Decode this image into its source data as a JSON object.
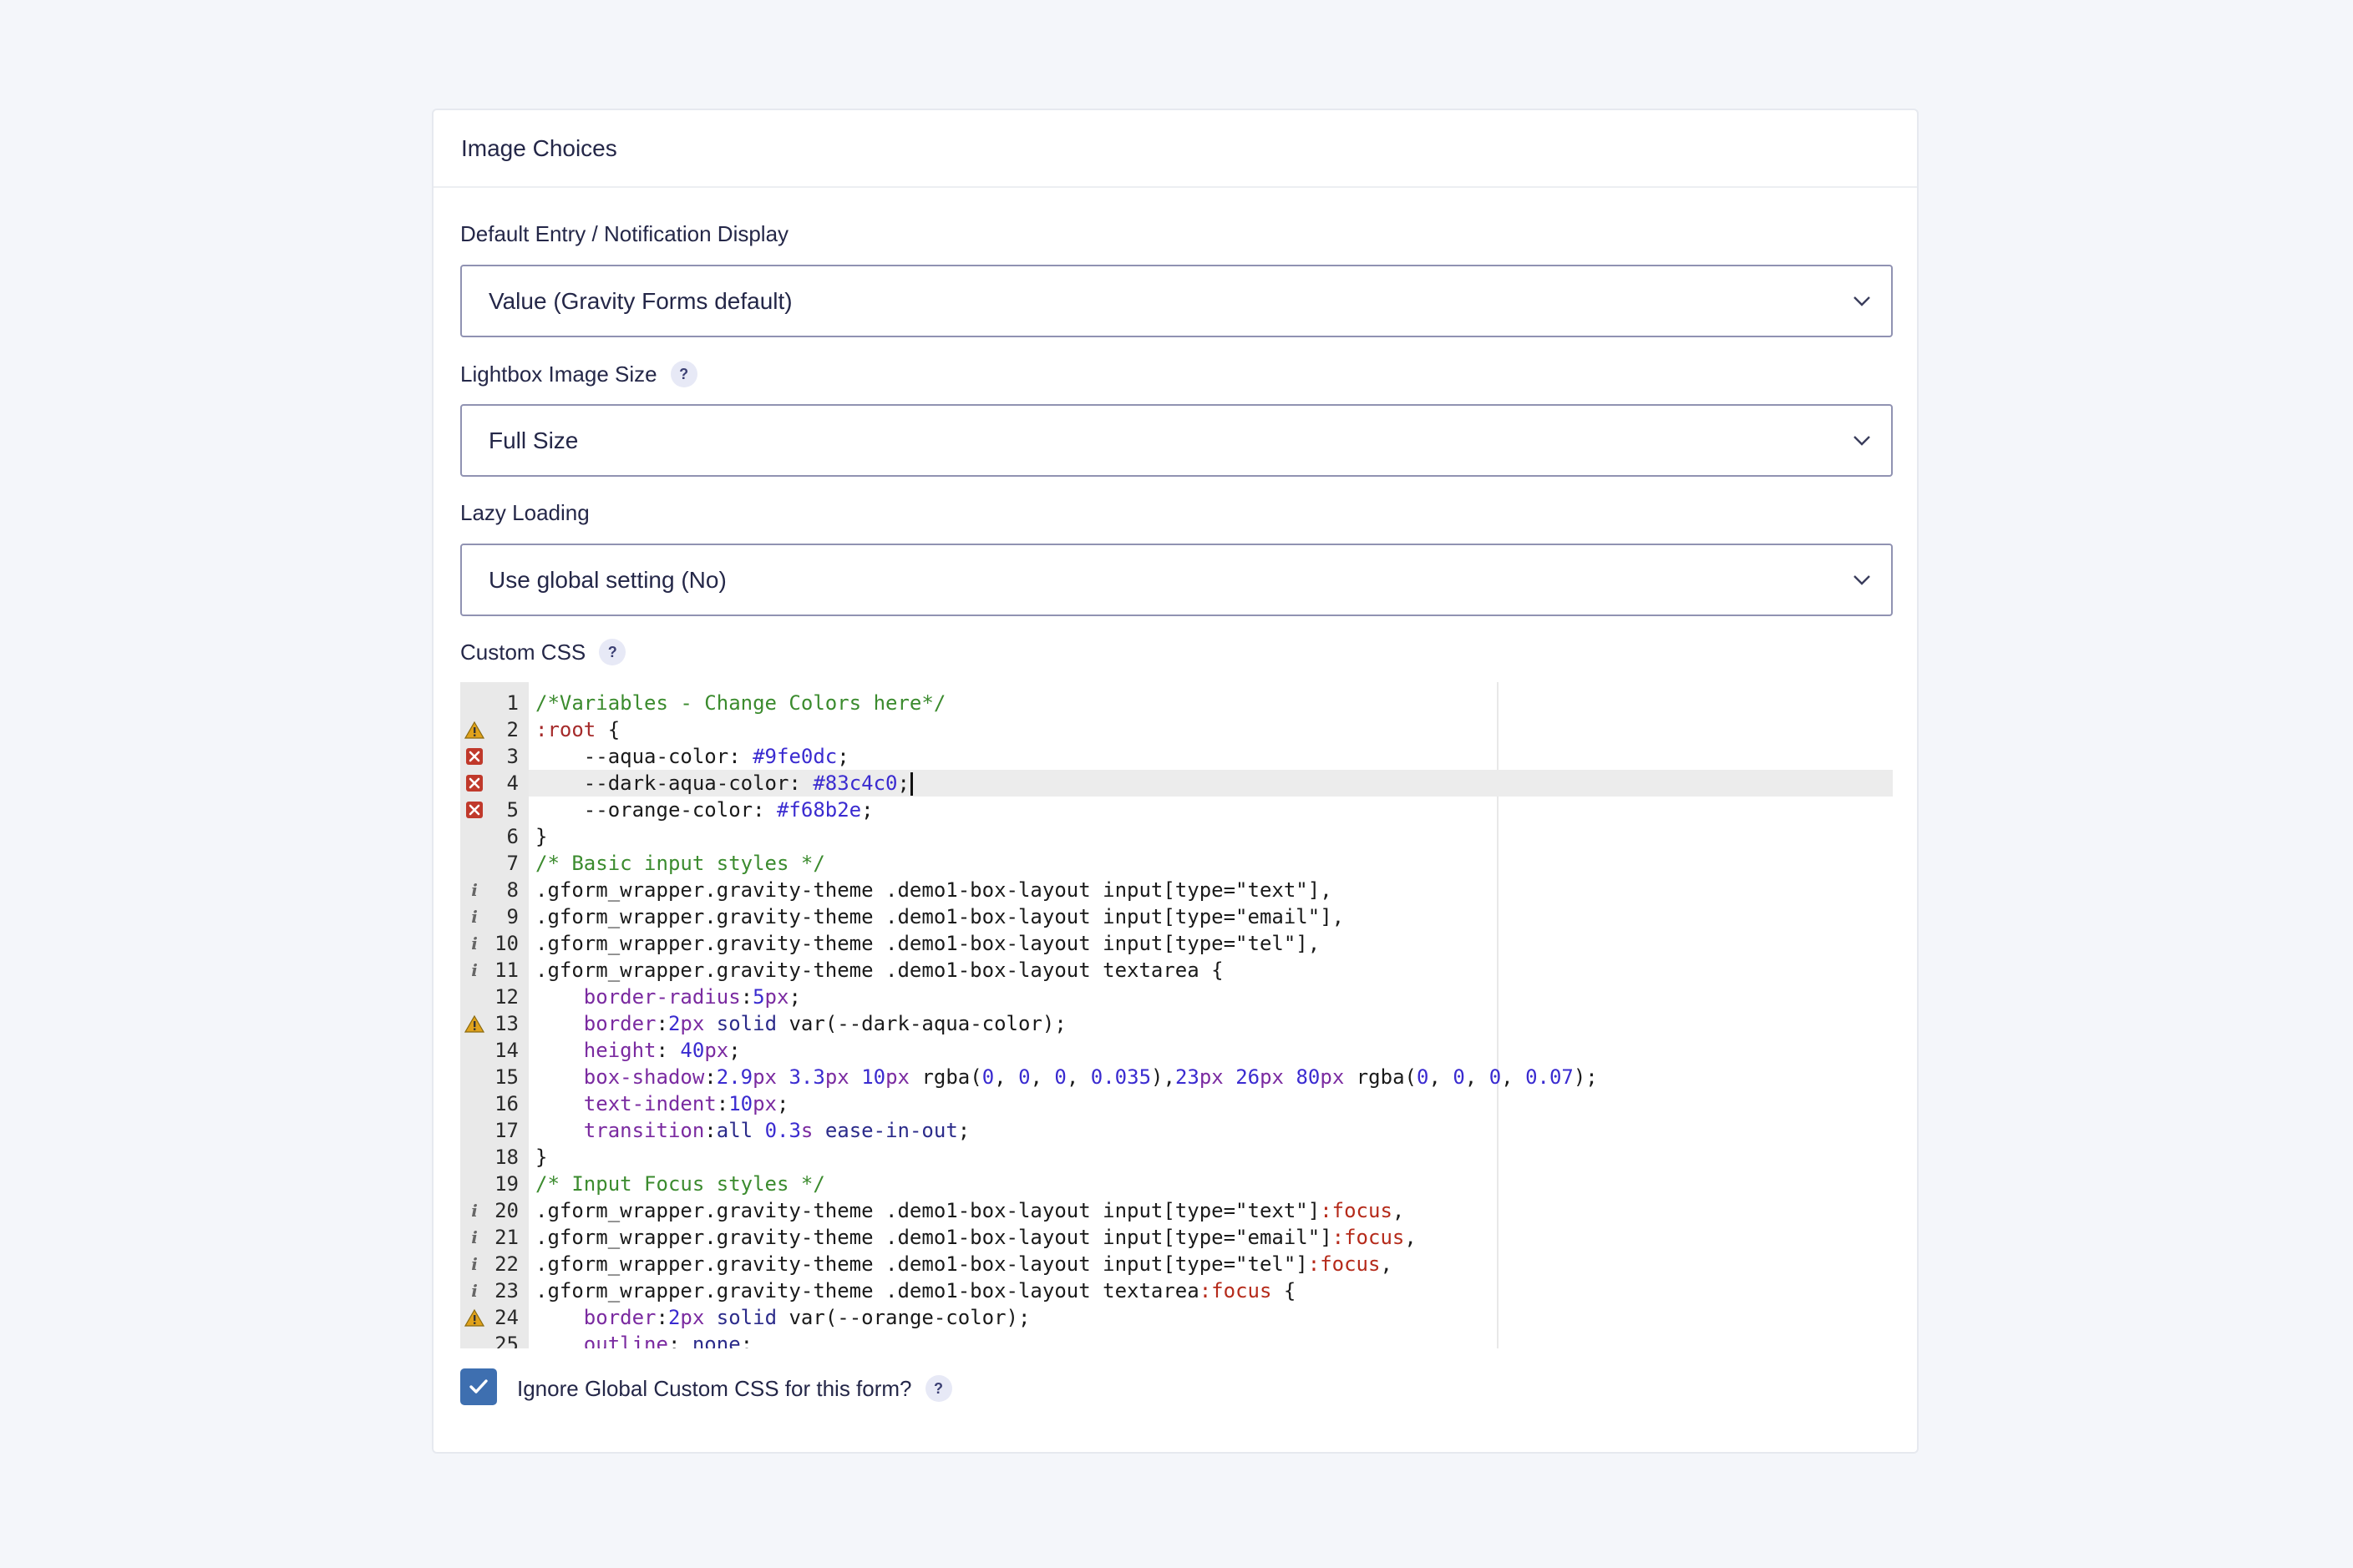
{
  "panel": {
    "title": "Image Choices"
  },
  "fields": {
    "default_display": {
      "label": "Default Entry / Notification Display",
      "value": "Value (Gravity Forms default)"
    },
    "lightbox_size": {
      "label": "Lightbox Image Size",
      "help": "?",
      "value": "Full Size"
    },
    "lazy_loading": {
      "label": "Lazy Loading",
      "value": "Use global setting (No)"
    },
    "custom_css": {
      "label": "Custom CSS",
      "help": "?"
    }
  },
  "editor": {
    "active_line": 4,
    "lines": [
      {
        "n": "1",
        "marker": "",
        "text": "/*Variables - Change Colors here*/"
      },
      {
        "n": "2",
        "marker": "warning",
        "text": ":root {"
      },
      {
        "n": "3",
        "marker": "error",
        "text": "    --aqua-color: #9fe0dc;"
      },
      {
        "n": "4",
        "marker": "error",
        "text": "    --dark-aqua-color: #83c4c0;"
      },
      {
        "n": "5",
        "marker": "error",
        "text": "    --orange-color: #f68b2e;"
      },
      {
        "n": "6",
        "marker": "",
        "text": "}"
      },
      {
        "n": "7",
        "marker": "",
        "text": "/* Basic input styles */"
      },
      {
        "n": "8",
        "marker": "info",
        "text": ".gform_wrapper.gravity-theme .demo1-box-layout input[type=\"text\"],"
      },
      {
        "n": "9",
        "marker": "info",
        "text": ".gform_wrapper.gravity-theme .demo1-box-layout input[type=\"email\"],"
      },
      {
        "n": "10",
        "marker": "info",
        "text": ".gform_wrapper.gravity-theme .demo1-box-layout input[type=\"tel\"],"
      },
      {
        "n": "11",
        "marker": "info",
        "text": ".gform_wrapper.gravity-theme .demo1-box-layout textarea {"
      },
      {
        "n": "12",
        "marker": "",
        "text": "    border-radius:5px;"
      },
      {
        "n": "13",
        "marker": "warning",
        "text": "    border:2px solid var(--dark-aqua-color);"
      },
      {
        "n": "14",
        "marker": "",
        "text": "    height: 40px;"
      },
      {
        "n": "15",
        "marker": "",
        "text": "    box-shadow:2.9px 3.3px 10px rgba(0, 0, 0, 0.035),23px 26px 80px rgba(0, 0, 0, 0.07);"
      },
      {
        "n": "16",
        "marker": "",
        "text": "    text-indent:10px;"
      },
      {
        "n": "17",
        "marker": "",
        "text": "    transition:all 0.3s ease-in-out;"
      },
      {
        "n": "18",
        "marker": "",
        "text": "}"
      },
      {
        "n": "19",
        "marker": "",
        "text": "/* Input Focus styles */"
      },
      {
        "n": "20",
        "marker": "info",
        "text": ".gform_wrapper.gravity-theme .demo1-box-layout input[type=\"text\"]:focus,"
      },
      {
        "n": "21",
        "marker": "info",
        "text": ".gform_wrapper.gravity-theme .demo1-box-layout input[type=\"email\"]:focus,"
      },
      {
        "n": "22",
        "marker": "info",
        "text": ".gform_wrapper.gravity-theme .demo1-box-layout input[type=\"tel\"]:focus,"
      },
      {
        "n": "23",
        "marker": "info",
        "text": ".gform_wrapper.gravity-theme .demo1-box-layout textarea:focus {"
      },
      {
        "n": "24",
        "marker": "warning",
        "text": "    border:2px solid var(--orange-color);"
      },
      {
        "n": "25",
        "marker": "",
        "text": "    outline: none;"
      }
    ]
  },
  "ignore_global": {
    "label": "Ignore Global Custom CSS for this form?",
    "checked": true,
    "help": "?"
  },
  "colors": {
    "accent": "#3e6fb0",
    "error": "#c0392b",
    "warning": "#e0a21b"
  }
}
